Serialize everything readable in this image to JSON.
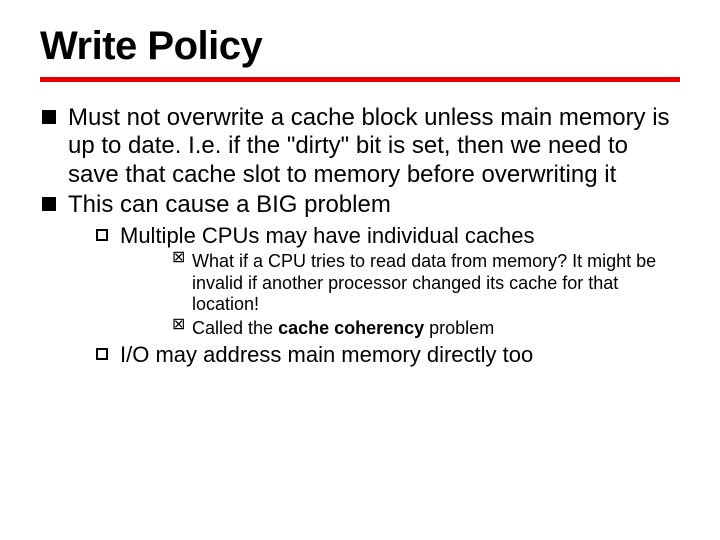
{
  "slide": {
    "title": "Write Policy",
    "bullets": {
      "b1": "Must not overwrite a cache block unless main memory is up to date.  I.e. if the \"dirty\" bit is set, then we need to save that cache slot to memory before overwriting it",
      "b2": "This can cause a BIG problem",
      "b2_1": "Multiple CPUs may have individual caches",
      "b2_1_a": "What if a CPU tries to read data from memory?  It might be invalid if another processor changed its cache for that location!",
      "b2_1_b_prefix": "Called the ",
      "b2_1_b_bold": "cache coherency",
      "b2_1_b_suffix": " problem",
      "b2_2": "I/O may address main memory directly too"
    }
  }
}
